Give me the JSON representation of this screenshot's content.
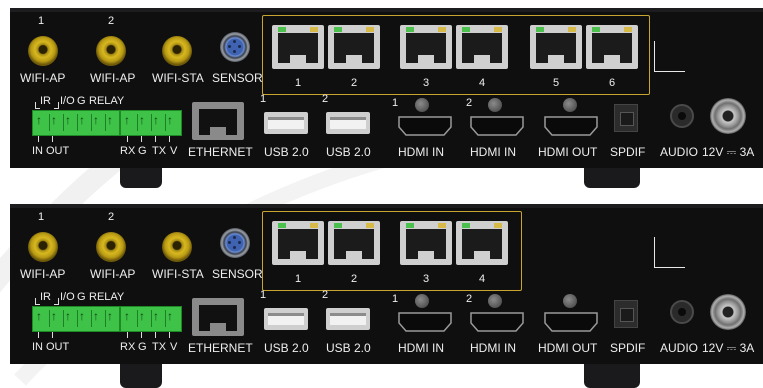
{
  "panels": [
    {
      "antenna_labels": [
        "WIFI-AP",
        "WIFI-AP",
        "WIFI-STA"
      ],
      "antenna_numbers": [
        "1",
        "2"
      ],
      "sensor_label": "SENSOR",
      "lan_numbers": [
        "1",
        "2",
        "3",
        "4",
        "5",
        "6"
      ],
      "terminal_top": [
        "IR",
        "I/O",
        "G",
        "RELAY"
      ],
      "terminal_bottom_left": [
        "IN",
        "OUT"
      ],
      "terminal_bottom_right": [
        "RX",
        "G",
        "TX",
        "V"
      ],
      "ethernet_label": "ETHERNET",
      "usb_numbers": [
        "1",
        "2"
      ],
      "usb_labels": [
        "USB 2.0",
        "USB 2.0"
      ],
      "hdmi_numbers": [
        "1",
        "2"
      ],
      "hdmi_labels": [
        "HDMI  IN",
        "HDMI  IN",
        "HDMI  OUT"
      ],
      "spdif_label": "SPDIF",
      "audio_label": "AUDIO",
      "power_label": "12V ⎓ 3A"
    },
    {
      "antenna_labels": [
        "WIFI-AP",
        "WIFI-AP",
        "WIFI-STA"
      ],
      "antenna_numbers": [
        "1",
        "2"
      ],
      "sensor_label": "SENSOR",
      "lan_numbers": [
        "1",
        "2",
        "3",
        "4"
      ],
      "terminal_top": [
        "IR",
        "I/O",
        "G",
        "RELAY"
      ],
      "terminal_bottom_left": [
        "IN",
        "OUT"
      ],
      "terminal_bottom_right": [
        "RX",
        "G",
        "TX",
        "V"
      ],
      "ethernet_label": "ETHERNET",
      "usb_numbers": [
        "1",
        "2"
      ],
      "usb_labels": [
        "USB 2.0",
        "USB 2.0"
      ],
      "hdmi_numbers": [
        "1",
        "2"
      ],
      "hdmi_labels": [
        "HDMI  IN",
        "HDMI  IN",
        "HDMI  OUT"
      ],
      "spdif_label": "SPDIF",
      "audio_label": "AUDIO",
      "power_label": "12V ⎓ 3A"
    }
  ],
  "colors": {
    "panel": "#0f0f10",
    "lan_box_border": "#c9a530",
    "terminal_green": "#3ec348",
    "text": "#eeeeee"
  },
  "icons": [
    "antenna-icon",
    "sensor-icon",
    "rj45-port-icon",
    "terminal-block-icon",
    "usb-port-icon",
    "hdmi-port-icon",
    "spdif-port-icon",
    "audio-jack-icon",
    "power-jack-icon"
  ]
}
